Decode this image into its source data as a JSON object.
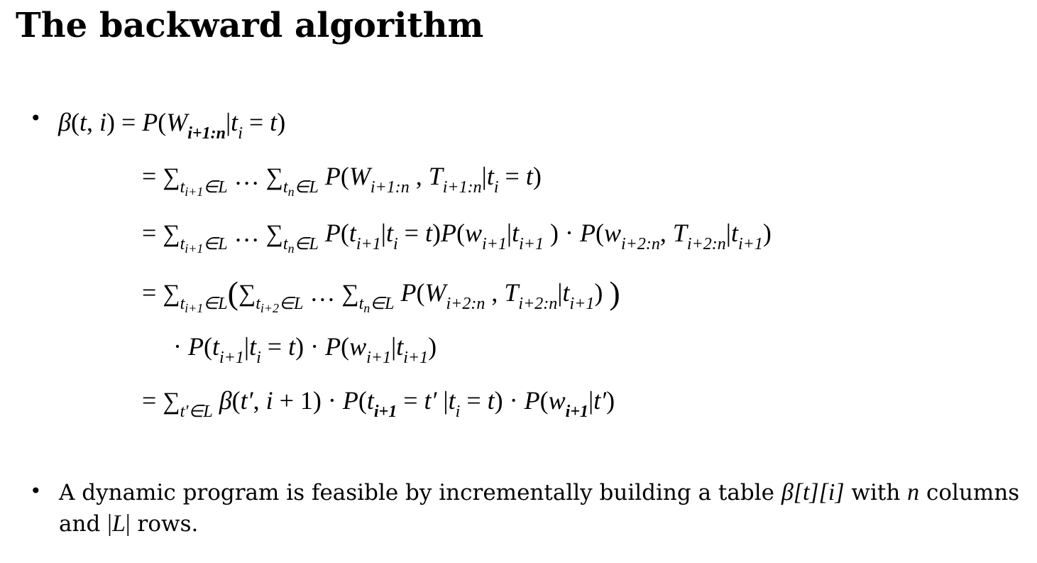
{
  "title": "The backward algorithm",
  "bullets": [
    "•",
    "•"
  ],
  "sentence": {
    "part1": "A dynamic program is feasible by incrementally building a table ",
    "table": "β[t][i]",
    "part2": " with ",
    "n": "n",
    "part3": " columns and ",
    "L": "|L|",
    "part4": " rows."
  }
}
